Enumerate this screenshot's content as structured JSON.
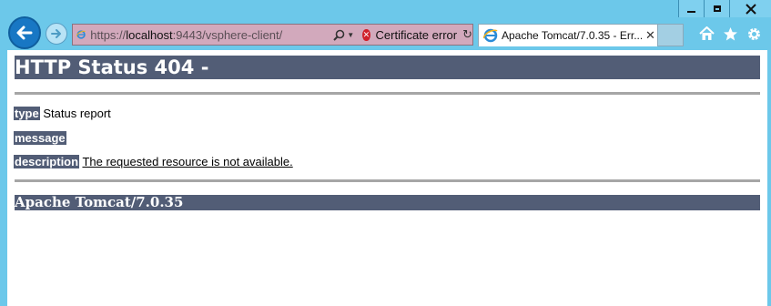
{
  "browser": {
    "address": {
      "protocol": "https://",
      "host": "localhost",
      "rest": ":9443/vsphere-client/",
      "cert_error": "Certificate error"
    },
    "tab": {
      "title": "Apache Tomcat/7.0.35 - Err..."
    }
  },
  "page": {
    "heading": "HTTP Status 404 -",
    "type_label": "type",
    "type_value": "Status report",
    "message_label": "message",
    "message_value": "",
    "description_label": "description",
    "description_value": "The requested resource is not available.",
    "footer": "Apache Tomcat/7.0.35"
  }
}
